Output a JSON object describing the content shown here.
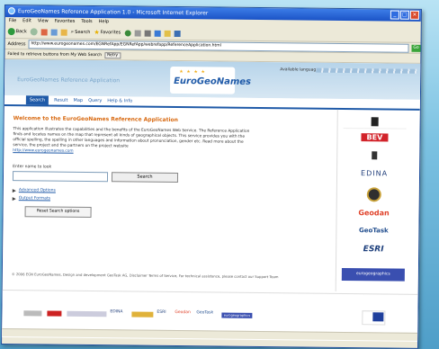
{
  "window": {
    "title": "EuroGeoNames Reference Application 1.0 - Microsoft Internet Explorer",
    "buttons": [
      "_",
      "□",
      "×"
    ]
  },
  "menubar": [
    "File",
    "Edit",
    "View",
    "Favorites",
    "Tools",
    "Help"
  ],
  "toolbar": {
    "back": "Back",
    "search": "Search",
    "favorites": "Favorites"
  },
  "address": {
    "label": "Address",
    "url": "http://www.eurogeonames.com/EGNRefApp/EGNRefApp/webrefapp/ReferenceApplication.html",
    "go": "Go"
  },
  "infobar": {
    "text": "Failed to retrieve buttons from My Web Search",
    "button": "Retry"
  },
  "site": {
    "name": "EuroGeoNames Reference Application",
    "logo": "EuroGeoNames",
    "available_languages": "Available languages:"
  },
  "nav": {
    "tabs": [
      "Search",
      "Result",
      "Map",
      "Query",
      "Help & Info"
    ]
  },
  "main": {
    "title": "Welcome to the EuroGeoNames Reference Application",
    "intro": "This application illustrates the capabilities and the benefits of the EuroGeoNames Web Service. The Reference Application finds and locates names on the map that represent all kinds of geographical objects. This service provides you with the official spelling, the spelling in other languages and information about pronunciation, gender etc. Read more about the service, the project and the partners on the project website",
    "website_link": "http://www.eurogeonames.com",
    "search_label": "Enter name to look",
    "search_button": "Search",
    "options": [
      "Advanced Options",
      "Output Formats"
    ],
    "reset_button": "Reset Search options"
  },
  "sidebar": {
    "partners": [
      "BEV",
      "EDINA",
      "Geodan",
      "GeoTask",
      "ESRI",
      "eurogeographics"
    ]
  },
  "footer": {
    "text": "© 2006 EGN EuroGeoNames, Design and development GeoTask AG, Disclaimer Terms of Service, For technical assistance, please contact our Support Team"
  },
  "partners_strip": {
    "logos": [
      "EDINA",
      "ESRI",
      "Geodan",
      "GeoTask",
      "eurogeographics"
    ]
  },
  "colors": {
    "accent": "#1f5aa8",
    "title_orange": "#d86a12",
    "header_blue": "#b7d4ea"
  }
}
